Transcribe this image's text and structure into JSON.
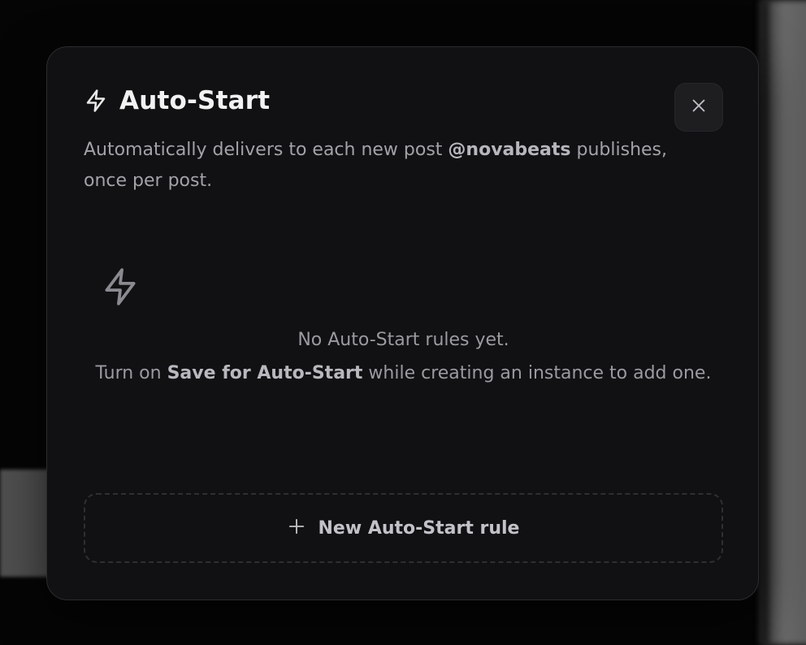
{
  "modal": {
    "title": "Auto-Start",
    "title_icon": "lightning-bolt-icon",
    "close_icon": "close-icon",
    "subtitle_prefix": "Automatically delivers to each new post ",
    "handle": "@novabeats",
    "subtitle_suffix": " publishes, once per post."
  },
  "empty_state": {
    "icon": "lightning-bolt-icon",
    "line1": "No Auto-Start rules yet.",
    "line2_prefix": "Turn on ",
    "line2_bold": "Save for Auto-Start",
    "line2_suffix": " while creating an instance to add one."
  },
  "new_rule_button": {
    "icon": "plus-icon",
    "label": "New Auto-Start rule"
  },
  "colors": {
    "modal_bg": "#111113",
    "title": "#f2f2f2",
    "muted_text": "#a2a2a8"
  }
}
